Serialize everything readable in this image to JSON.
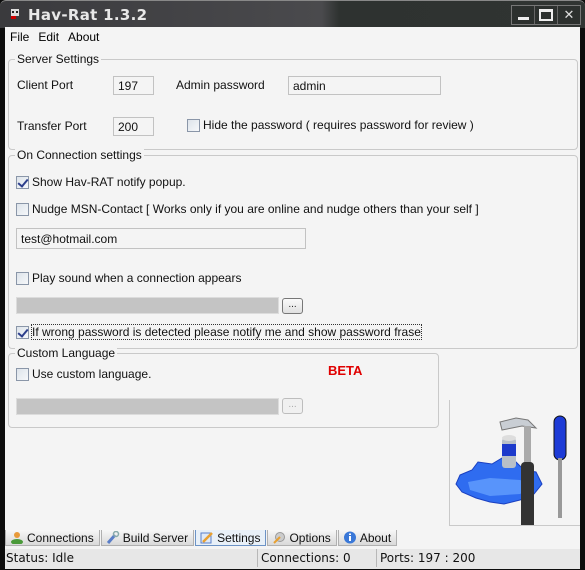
{
  "window": {
    "title": "Hav-Rat 1.3.2",
    "controls": {
      "minimize": "minimize-icon",
      "maximize": "maximize-icon",
      "close": "close-icon"
    }
  },
  "menu": [
    {
      "label": "File",
      "accel": "F"
    },
    {
      "label": "Edit",
      "accel": "E"
    },
    {
      "label": "About",
      "accel": "A"
    }
  ],
  "server_settings": {
    "title": "Server Settings",
    "client_port_label": "Client Port",
    "client_port_value": "197",
    "transfer_port_label": "Transfer Port",
    "transfer_port_value": "200",
    "admin_password_label": "Admin password",
    "admin_password_value": "admin",
    "hide_password_label": "Hide the password ( requires password for review )",
    "hide_password_checked": false
  },
  "connection_settings": {
    "title": "On Connection settings",
    "show_popup_label": "Show Hav-RAT notify popup.",
    "show_popup_checked": true,
    "nudge_label": "Nudge MSN-Contact [ Works only if you are online and nudge others than your self ]",
    "nudge_checked": false,
    "email_value": "test@hotmail.com",
    "play_sound_label": "Play sound when a connection appears",
    "play_sound_checked": false,
    "sound_path_value": "",
    "browse_label": "...",
    "wrong_password_label": "If wrong password is detected please notify me and show password frase",
    "wrong_password_checked": true
  },
  "custom_language": {
    "title": "Custom Language",
    "use_custom_label": "Use custom language.",
    "use_custom_checked": false,
    "beta_label": "BETA",
    "language_path_value": "",
    "browse_label": "..."
  },
  "tabs": [
    {
      "label": "Connections",
      "icon": "user-icon",
      "active": false
    },
    {
      "label": "Build Server",
      "icon": "wrench-icon",
      "active": false
    },
    {
      "label": "Settings",
      "icon": "pencil-icon",
      "active": true
    },
    {
      "label": "Options",
      "icon": "gears-icon",
      "active": false
    },
    {
      "label": "About",
      "icon": "info-icon",
      "active": false
    }
  ],
  "status": {
    "status": "Status: Idle",
    "connections": "Connections: 0",
    "ports": "Ports: 197 : 200"
  },
  "colors": {
    "beta": "#e00000",
    "active_tab_border": "#6c93c6"
  }
}
